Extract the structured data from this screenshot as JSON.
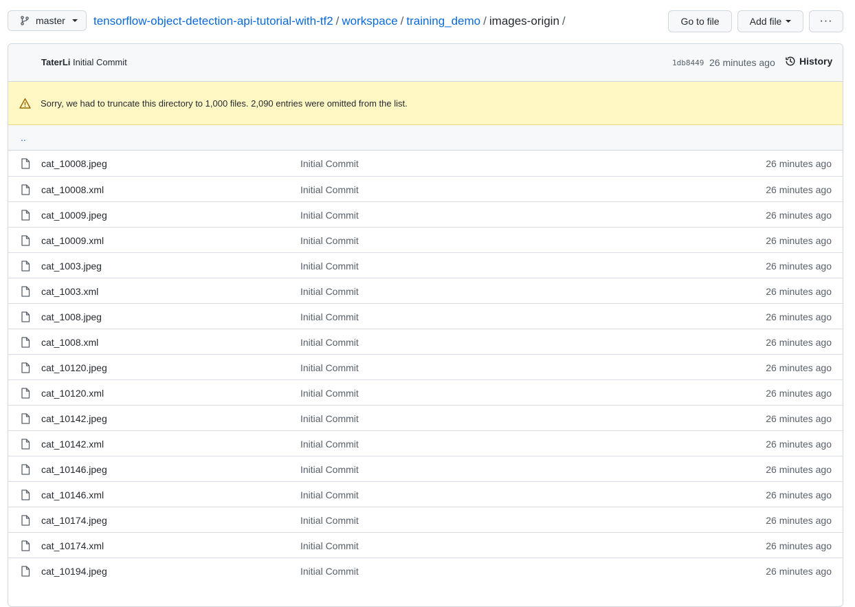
{
  "branch": {
    "label": "master"
  },
  "breadcrumb": {
    "repo": "tensorflow-object-detection-api-tutorial-with-tf2",
    "parts": [
      "workspace",
      "training_demo"
    ],
    "current": "images-origin",
    "sep": "/"
  },
  "actions": {
    "goto_label": "Go to file",
    "addfile_label": "Add file",
    "more_label": "···"
  },
  "commit": {
    "author": "TaterLi",
    "message": "Initial Commit",
    "sha": "1db8449",
    "time": "26 minutes ago",
    "history_label": "History"
  },
  "flash": {
    "text": "Sorry, we had to truncate this directory to 1,000 files. 2,090 entries were omitted from the list."
  },
  "updir": {
    "label": ".."
  },
  "files": [
    {
      "name": "cat_10008.jpeg",
      "message": "Initial Commit",
      "time": "26 minutes ago"
    },
    {
      "name": "cat_10008.xml",
      "message": "Initial Commit",
      "time": "26 minutes ago"
    },
    {
      "name": "cat_10009.jpeg",
      "message": "Initial Commit",
      "time": "26 minutes ago"
    },
    {
      "name": "cat_10009.xml",
      "message": "Initial Commit",
      "time": "26 minutes ago"
    },
    {
      "name": "cat_1003.jpeg",
      "message": "Initial Commit",
      "time": "26 minutes ago"
    },
    {
      "name": "cat_1003.xml",
      "message": "Initial Commit",
      "time": "26 minutes ago"
    },
    {
      "name": "cat_1008.jpeg",
      "message": "Initial Commit",
      "time": "26 minutes ago"
    },
    {
      "name": "cat_1008.xml",
      "message": "Initial Commit",
      "time": "26 minutes ago"
    },
    {
      "name": "cat_10120.jpeg",
      "message": "Initial Commit",
      "time": "26 minutes ago"
    },
    {
      "name": "cat_10120.xml",
      "message": "Initial Commit",
      "time": "26 minutes ago"
    },
    {
      "name": "cat_10142.jpeg",
      "message": "Initial Commit",
      "time": "26 minutes ago"
    },
    {
      "name": "cat_10142.xml",
      "message": "Initial Commit",
      "time": "26 minutes ago"
    },
    {
      "name": "cat_10146.jpeg",
      "message": "Initial Commit",
      "time": "26 minutes ago"
    },
    {
      "name": "cat_10146.xml",
      "message": "Initial Commit",
      "time": "26 minutes ago"
    },
    {
      "name": "cat_10174.jpeg",
      "message": "Initial Commit",
      "time": "26 minutes ago"
    },
    {
      "name": "cat_10174.xml",
      "message": "Initial Commit",
      "time": "26 minutes ago"
    },
    {
      "name": "cat_10194.jpeg",
      "message": "Initial Commit",
      "time": "26 minutes ago"
    }
  ]
}
